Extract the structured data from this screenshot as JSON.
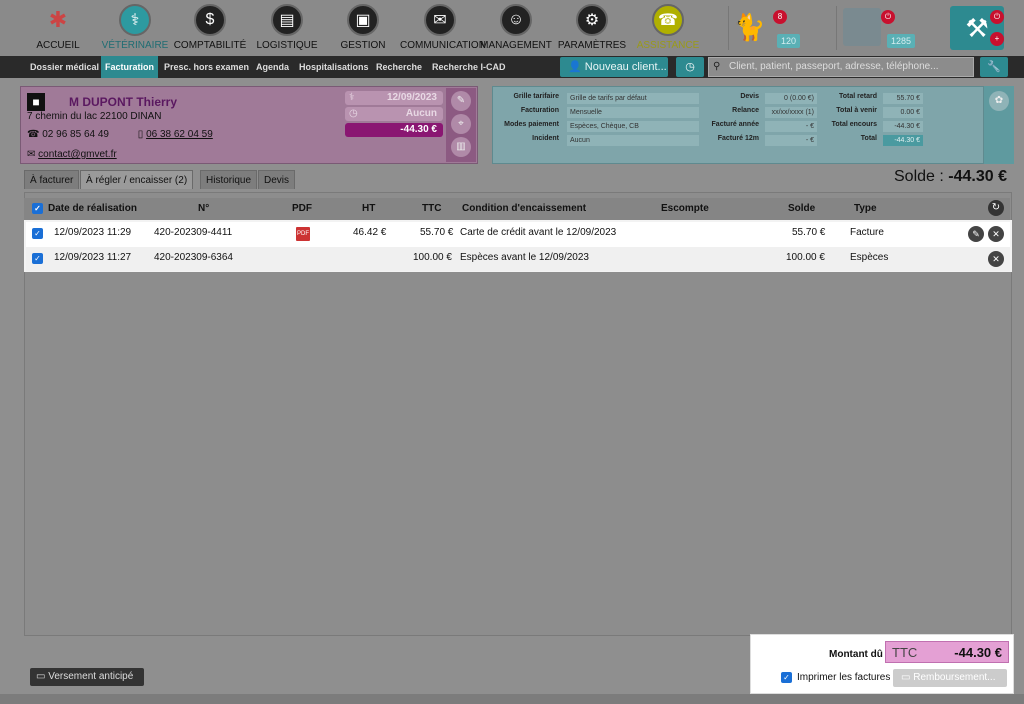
{
  "nav": {
    "items": [
      {
        "label": "ACCUEIL",
        "icon": "pinwheel-logo-icon"
      },
      {
        "label": "VÉTÉRINAIRE",
        "icon": "stethoscope-icon"
      },
      {
        "label": "COMPTABILITÉ",
        "icon": "piggy-bank-icon"
      },
      {
        "label": "LOGISTIQUE",
        "icon": "book-icon"
      },
      {
        "label": "GESTION",
        "icon": "folder-icon"
      },
      {
        "label": "COMMUNICATION",
        "icon": "chat-bubbles-icon"
      },
      {
        "label": "MANAGEMENT",
        "icon": "people-icon"
      },
      {
        "label": "PARAMÈTRES",
        "icon": "gear-icon"
      },
      {
        "label": "ASSISTANCE",
        "icon": "support-agent-icon"
      }
    ],
    "pets_badge": "8",
    "pets_count": "120",
    "user_count": "1285"
  },
  "subnav": {
    "items": [
      "Dossier médical",
      "Facturation",
      "Presc. hors examen",
      "Agenda",
      "Hospitalisations",
      "Recherche",
      "Recherche I-CAD"
    ],
    "new_client": "Nouveau client...",
    "search_placeholder": "Client, patient, passeport, adresse, téléphone..."
  },
  "client": {
    "name": "M DUPONT Thierry",
    "address": "7 chemin du lac 22100 DINAN",
    "phone": "02 96 85 64 49",
    "mobile": "06 38 62 04 59",
    "email": "contact@gmvet.fr",
    "date": "12/09/2023",
    "status": "Aucun",
    "balance": "-44.30 €"
  },
  "tariff": {
    "grille_label": "Grille tarifaire",
    "grille_value": "Grille de tarifs par défaut",
    "facturation_label": "Facturation",
    "facturation_value": "Mensuelle",
    "modes_label": "Modes paiement",
    "modes_value": "Espèces, Chèque, CB",
    "incident_label": "Incident",
    "incident_value": "Aucun",
    "devis_label": "Devis",
    "devis_value": "0 (0.00 €)",
    "relance_label": "Relance",
    "relance_value": "xx/xx/xxxx (1)",
    "facture_annee_label": "Facturé année",
    "facture_annee_value": "- €",
    "facture_12m_label": "Facturé 12m",
    "facture_12m_value": "- €",
    "retard_label": "Total retard",
    "retard_value": "55.70 €",
    "avenir_label": "Total à venir",
    "avenir_value": "0.00 €",
    "encours_label": "Total encours",
    "encours_value": "-44.30 €",
    "total_label": "Total",
    "total_value": "-44.30 €"
  },
  "tabs": [
    "À facturer",
    "À régler / encaisser (2)",
    "Historique",
    "Devis"
  ],
  "solde": {
    "label": "Solde :",
    "value": "-44.30 €"
  },
  "table": {
    "headers": [
      "Date de réalisation",
      "N°",
      "PDF",
      "HT",
      "TTC",
      "Condition d'encaissement",
      "Escompte",
      "Solde",
      "Type"
    ],
    "rows": [
      {
        "date": "12/09/2023 11:29",
        "num": "420-202309-4411",
        "pdf": "PDF",
        "ht": "46.42 €",
        "ttc": "55.70 €",
        "cond": "Carte de crédit avant le 12/09/2023",
        "solde": "55.70 €",
        "type": "Facture"
      },
      {
        "date": "12/09/2023 11:27",
        "num": "420-202309-6364",
        "pdf": "",
        "ht": "",
        "ttc": "100.00 €",
        "cond": "Espèces avant le 12/09/2023",
        "solde": "100.00 €",
        "type": "Espèces"
      }
    ]
  },
  "footer": {
    "versement": "Versement anticipé",
    "montant_label": "Montant dû",
    "montant_ttc": "TTC",
    "montant_value": "-44.30 €",
    "print_label": "Imprimer les factures",
    "remboursement": "Remboursement..."
  }
}
